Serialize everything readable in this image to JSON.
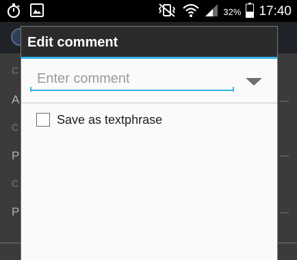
{
  "status_bar": {
    "time": "17:40",
    "battery_percent": "32%",
    "icons": [
      "stopwatch-icon",
      "image-icon",
      "vibrate-mute-icon",
      "wifi-icon",
      "signal-icon",
      "battery-icon"
    ]
  },
  "background": {
    "rows": [
      {
        "text": "C",
        "style": "small"
      },
      {
        "text": "A",
        "style": "big"
      },
      {
        "text": "C",
        "style": "small"
      },
      {
        "text": "P",
        "style": "big"
      },
      {
        "text": "C",
        "style": "small"
      },
      {
        "text": "P",
        "style": "big"
      }
    ]
  },
  "dialog": {
    "title": "Edit comment",
    "comment_input": {
      "placeholder": "Enter comment",
      "value": ""
    },
    "dropdown_icon": "caret-down-icon",
    "checkbox": {
      "label": "Save as textphrase",
      "checked": false
    }
  },
  "colors": {
    "accent": "#33b5e5",
    "dialog_title_bg": "#2b2b2b",
    "dialog_body_bg": "#fafafa"
  }
}
